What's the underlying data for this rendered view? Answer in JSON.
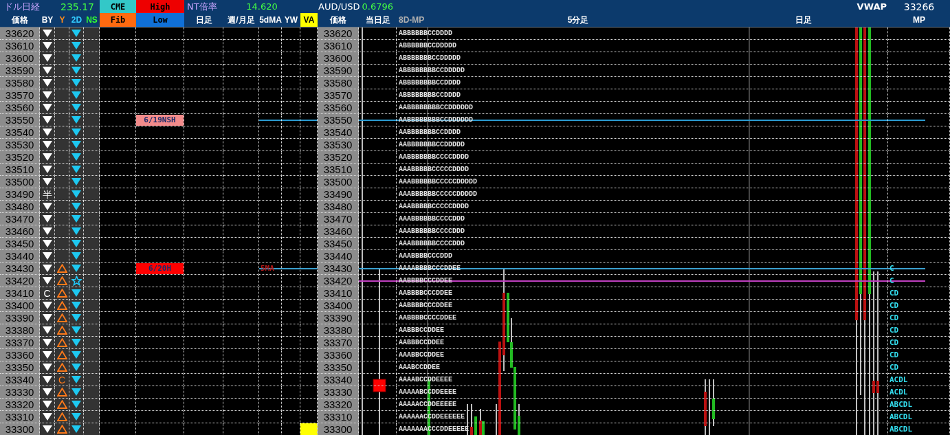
{
  "header": {
    "title": "ドル日経",
    "title_value": "235.17",
    "cme": "CME",
    "high": "High",
    "fib": "Fib",
    "low": "Low",
    "nt_label": "NT倍率",
    "nt_value": "14.620",
    "fx_label": "AUD/USD",
    "fx_value": "0.6796",
    "vwap_label": "VWAP",
    "vwap_value": "33266"
  },
  "columns": [
    {
      "label": "価格",
      "highlight": false
    },
    {
      "label": "BY",
      "highlight": false
    },
    {
      "label": "Y",
      "highlight": false
    },
    {
      "label": "2D",
      "highlight": false
    },
    {
      "label": "NS",
      "highlight": false
    },
    {
      "label": "日足",
      "highlight": false
    },
    {
      "label": "週/月足",
      "highlight": false
    },
    {
      "label": "5dMA",
      "highlight": false
    },
    {
      "label": "YW",
      "highlight": false
    },
    {
      "label": "VA",
      "highlight": true
    },
    {
      "label": "価格",
      "highlight": false
    },
    {
      "label": "当日足",
      "highlight": false
    },
    {
      "label": "8D-MP",
      "highlight": false
    },
    {
      "label": "5分足",
      "highlight": false
    },
    {
      "label": "日足",
      "highlight": false
    },
    {
      "label": "MP",
      "highlight": false
    }
  ],
  "rows": [
    {
      "price": "33620",
      "by": {
        "kind": "down"
      },
      "y": {
        "kind": "none"
      },
      "d2": {
        "kind": "down"
      },
      "va": false,
      "price2": "33620",
      "mp": "ABBBBBBCCDDDD"
    },
    {
      "price": "33610",
      "by": {
        "kind": "down"
      },
      "y": {
        "kind": "none"
      },
      "d2": {
        "kind": "down"
      },
      "va": false,
      "price2": "33610",
      "mp": "ABBBBBBCCDDDDD"
    },
    {
      "price": "33600",
      "by": {
        "kind": "down"
      },
      "y": {
        "kind": "none"
      },
      "d2": {
        "kind": "down"
      },
      "va": false,
      "price2": "33600",
      "mp": "ABBBBBBBCCDDDDD"
    },
    {
      "price": "33590",
      "by": {
        "kind": "down"
      },
      "y": {
        "kind": "none"
      },
      "d2": {
        "kind": "down"
      },
      "va": false,
      "price2": "33590",
      "mp": "ABBBBBBBBCCDDDDD"
    },
    {
      "price": "33580",
      "by": {
        "kind": "down"
      },
      "y": {
        "kind": "none"
      },
      "d2": {
        "kind": "down"
      },
      "va": false,
      "price2": "33580",
      "mp": "ABBBBBBBBCCDDDD"
    },
    {
      "price": "33570",
      "by": {
        "kind": "down"
      },
      "y": {
        "kind": "none"
      },
      "d2": {
        "kind": "down"
      },
      "va": false,
      "price2": "33570",
      "mp": "ABBBBBBBBCCDDDD"
    },
    {
      "price": "33560",
      "by": {
        "kind": "down"
      },
      "y": {
        "kind": "none"
      },
      "d2": {
        "kind": "down"
      },
      "va": false,
      "price2": "33560",
      "mp": "AABBBBBBBBCCDDDDDD"
    },
    {
      "price": "33550",
      "by": {
        "kind": "down"
      },
      "y": {
        "kind": "none"
      },
      "d2": {
        "kind": "down"
      },
      "va": false,
      "price2": "33550",
      "mp": "AABBBBBBBBCCDDDDDD",
      "marker": {
        "text": "6/19NSH",
        "color": "#f28b8b"
      }
    },
    {
      "price": "33540",
      "by": {
        "kind": "down"
      },
      "y": {
        "kind": "none"
      },
      "d2": {
        "kind": "down"
      },
      "va": false,
      "price2": "33540",
      "mp": "AABBBBBBBCCDDDD"
    },
    {
      "price": "33530",
      "by": {
        "kind": "down"
      },
      "y": {
        "kind": "none"
      },
      "d2": {
        "kind": "down"
      },
      "va": false,
      "price2": "33530",
      "mp": "AABBBBBBBCCDDDDD"
    },
    {
      "price": "33520",
      "by": {
        "kind": "down"
      },
      "y": {
        "kind": "none"
      },
      "d2": {
        "kind": "down"
      },
      "va": false,
      "price2": "33520",
      "mp": "AABBBBBBBCCCCDDDD"
    },
    {
      "price": "33510",
      "by": {
        "kind": "down"
      },
      "y": {
        "kind": "none"
      },
      "d2": {
        "kind": "down"
      },
      "va": false,
      "price2": "33510",
      "mp": "AAABBBBBCCCCCDDDD"
    },
    {
      "price": "33500",
      "by": {
        "kind": "down"
      },
      "y": {
        "kind": "none"
      },
      "d2": {
        "kind": "down"
      },
      "va": false,
      "price2": "33500",
      "mp": "AAABBBBBBCCCCCDDDDD"
    },
    {
      "price": "33490",
      "by": {
        "kind": "text",
        "text": "半"
      },
      "y": {
        "kind": "none"
      },
      "d2": {
        "kind": "down"
      },
      "va": false,
      "price2": "33490",
      "mp": "AAABBBBBBCCCCCDDDDD"
    },
    {
      "price": "33480",
      "by": {
        "kind": "down"
      },
      "y": {
        "kind": "none"
      },
      "d2": {
        "kind": "down"
      },
      "va": false,
      "price2": "33480",
      "mp": "AAABBBBBCCCCCDDDD"
    },
    {
      "price": "33470",
      "by": {
        "kind": "down"
      },
      "y": {
        "kind": "none"
      },
      "d2": {
        "kind": "down"
      },
      "va": false,
      "price2": "33470",
      "mp": "AAABBBBBBCCCCDDD"
    },
    {
      "price": "33460",
      "by": {
        "kind": "down"
      },
      "y": {
        "kind": "none"
      },
      "d2": {
        "kind": "down"
      },
      "va": false,
      "price2": "33460",
      "mp": "AAABBBBBBCCCCDDD"
    },
    {
      "price": "33450",
      "by": {
        "kind": "down"
      },
      "y": {
        "kind": "none"
      },
      "d2": {
        "kind": "down"
      },
      "va": false,
      "price2": "33450",
      "mp": "AAABBBBBBCCCCDDD"
    },
    {
      "price": "33440",
      "by": {
        "kind": "down"
      },
      "y": {
        "kind": "none"
      },
      "d2": {
        "kind": "down"
      },
      "va": false,
      "price2": "33440",
      "mp": "AAABBBBCCCDDD"
    },
    {
      "price": "33430",
      "by": {
        "kind": "down"
      },
      "y": {
        "kind": "up"
      },
      "d2": {
        "kind": "down"
      },
      "va": false,
      "price2": "33430",
      "mp": "AAAABBBBCCCDDEE",
      "marker": {
        "text": "6/20H",
        "color": "#ff0000"
      },
      "ma_label": "5MA",
      "mp_letters": "C"
    },
    {
      "price": "33420",
      "by": {
        "kind": "down"
      },
      "y": {
        "kind": "up"
      },
      "d2": {
        "kind": "star"
      },
      "va": false,
      "price2": "33420",
      "mp": "AABBBBCCCDDEE",
      "mp_letters": "C"
    },
    {
      "price": "33410",
      "by": {
        "kind": "text",
        "text": "C"
      },
      "y": {
        "kind": "up"
      },
      "d2": {
        "kind": "down"
      },
      "va": false,
      "price2": "33410",
      "mp": "AABBBBCCCDDEE",
      "mp_letters": "CD"
    },
    {
      "price": "33400",
      "by": {
        "kind": "down"
      },
      "y": {
        "kind": "up"
      },
      "d2": {
        "kind": "down"
      },
      "va": false,
      "price2": "33400",
      "mp": "AABBBBCCCDDEE",
      "mp_letters": "CD"
    },
    {
      "price": "33390",
      "by": {
        "kind": "down"
      },
      "y": {
        "kind": "up"
      },
      "d2": {
        "kind": "down"
      },
      "va": false,
      "price2": "33390",
      "mp": "AABBBBCCCCDDEE",
      "mp_letters": "CD"
    },
    {
      "price": "33380",
      "by": {
        "kind": "down"
      },
      "y": {
        "kind": "up"
      },
      "d2": {
        "kind": "down"
      },
      "va": false,
      "price2": "33380",
      "mp": "AABBBCCDDEE",
      "mp_letters": "CD"
    },
    {
      "price": "33370",
      "by": {
        "kind": "down"
      },
      "y": {
        "kind": "up"
      },
      "d2": {
        "kind": "down"
      },
      "va": false,
      "price2": "33370",
      "mp": "AABBBCCDDEE",
      "mp_letters": "CD"
    },
    {
      "price": "33360",
      "by": {
        "kind": "down"
      },
      "y": {
        "kind": "up"
      },
      "d2": {
        "kind": "down"
      },
      "va": false,
      "price2": "33360",
      "mp": "AAABBCCDDEE",
      "mp_letters": "CD"
    },
    {
      "price": "33350",
      "by": {
        "kind": "down"
      },
      "y": {
        "kind": "up"
      },
      "d2": {
        "kind": "down"
      },
      "va": false,
      "price2": "33350",
      "mp": "AAABCCDDEE",
      "mp_letters": "CD"
    },
    {
      "price": "33340",
      "by": {
        "kind": "down"
      },
      "y": {
        "kind": "text",
        "text": "C"
      },
      "d2": {
        "kind": "down"
      },
      "va": false,
      "price2": "33340",
      "mp": "AAAABCCDDEEEE",
      "mp_letters": "ACDL"
    },
    {
      "price": "33330",
      "by": {
        "kind": "down"
      },
      "y": {
        "kind": "up"
      },
      "d2": {
        "kind": "down"
      },
      "va": false,
      "price2": "33330",
      "mp": "AAAAABCCDDEEEE",
      "mp_letters": "ACDL"
    },
    {
      "price": "33320",
      "by": {
        "kind": "down"
      },
      "y": {
        "kind": "up"
      },
      "d2": {
        "kind": "down"
      },
      "va": false,
      "price2": "33320",
      "mp": "AAAAACCDDEEEEE",
      "mp_letters": "ABCDL"
    },
    {
      "price": "33310",
      "by": {
        "kind": "down"
      },
      "y": {
        "kind": "up"
      },
      "d2": {
        "kind": "down"
      },
      "va": false,
      "price2": "33310",
      "mp": "AAAAAACCDDEEEEEE",
      "mp_letters": "ABCDL"
    },
    {
      "price": "33300",
      "by": {
        "kind": "down"
      },
      "y": {
        "kind": "up"
      },
      "d2": {
        "kind": "down"
      },
      "va": true,
      "price2": "33300",
      "mp": "AAAAAAACCCDDEEEEE",
      "mp_letters": "ABCDL"
    }
  ]
}
